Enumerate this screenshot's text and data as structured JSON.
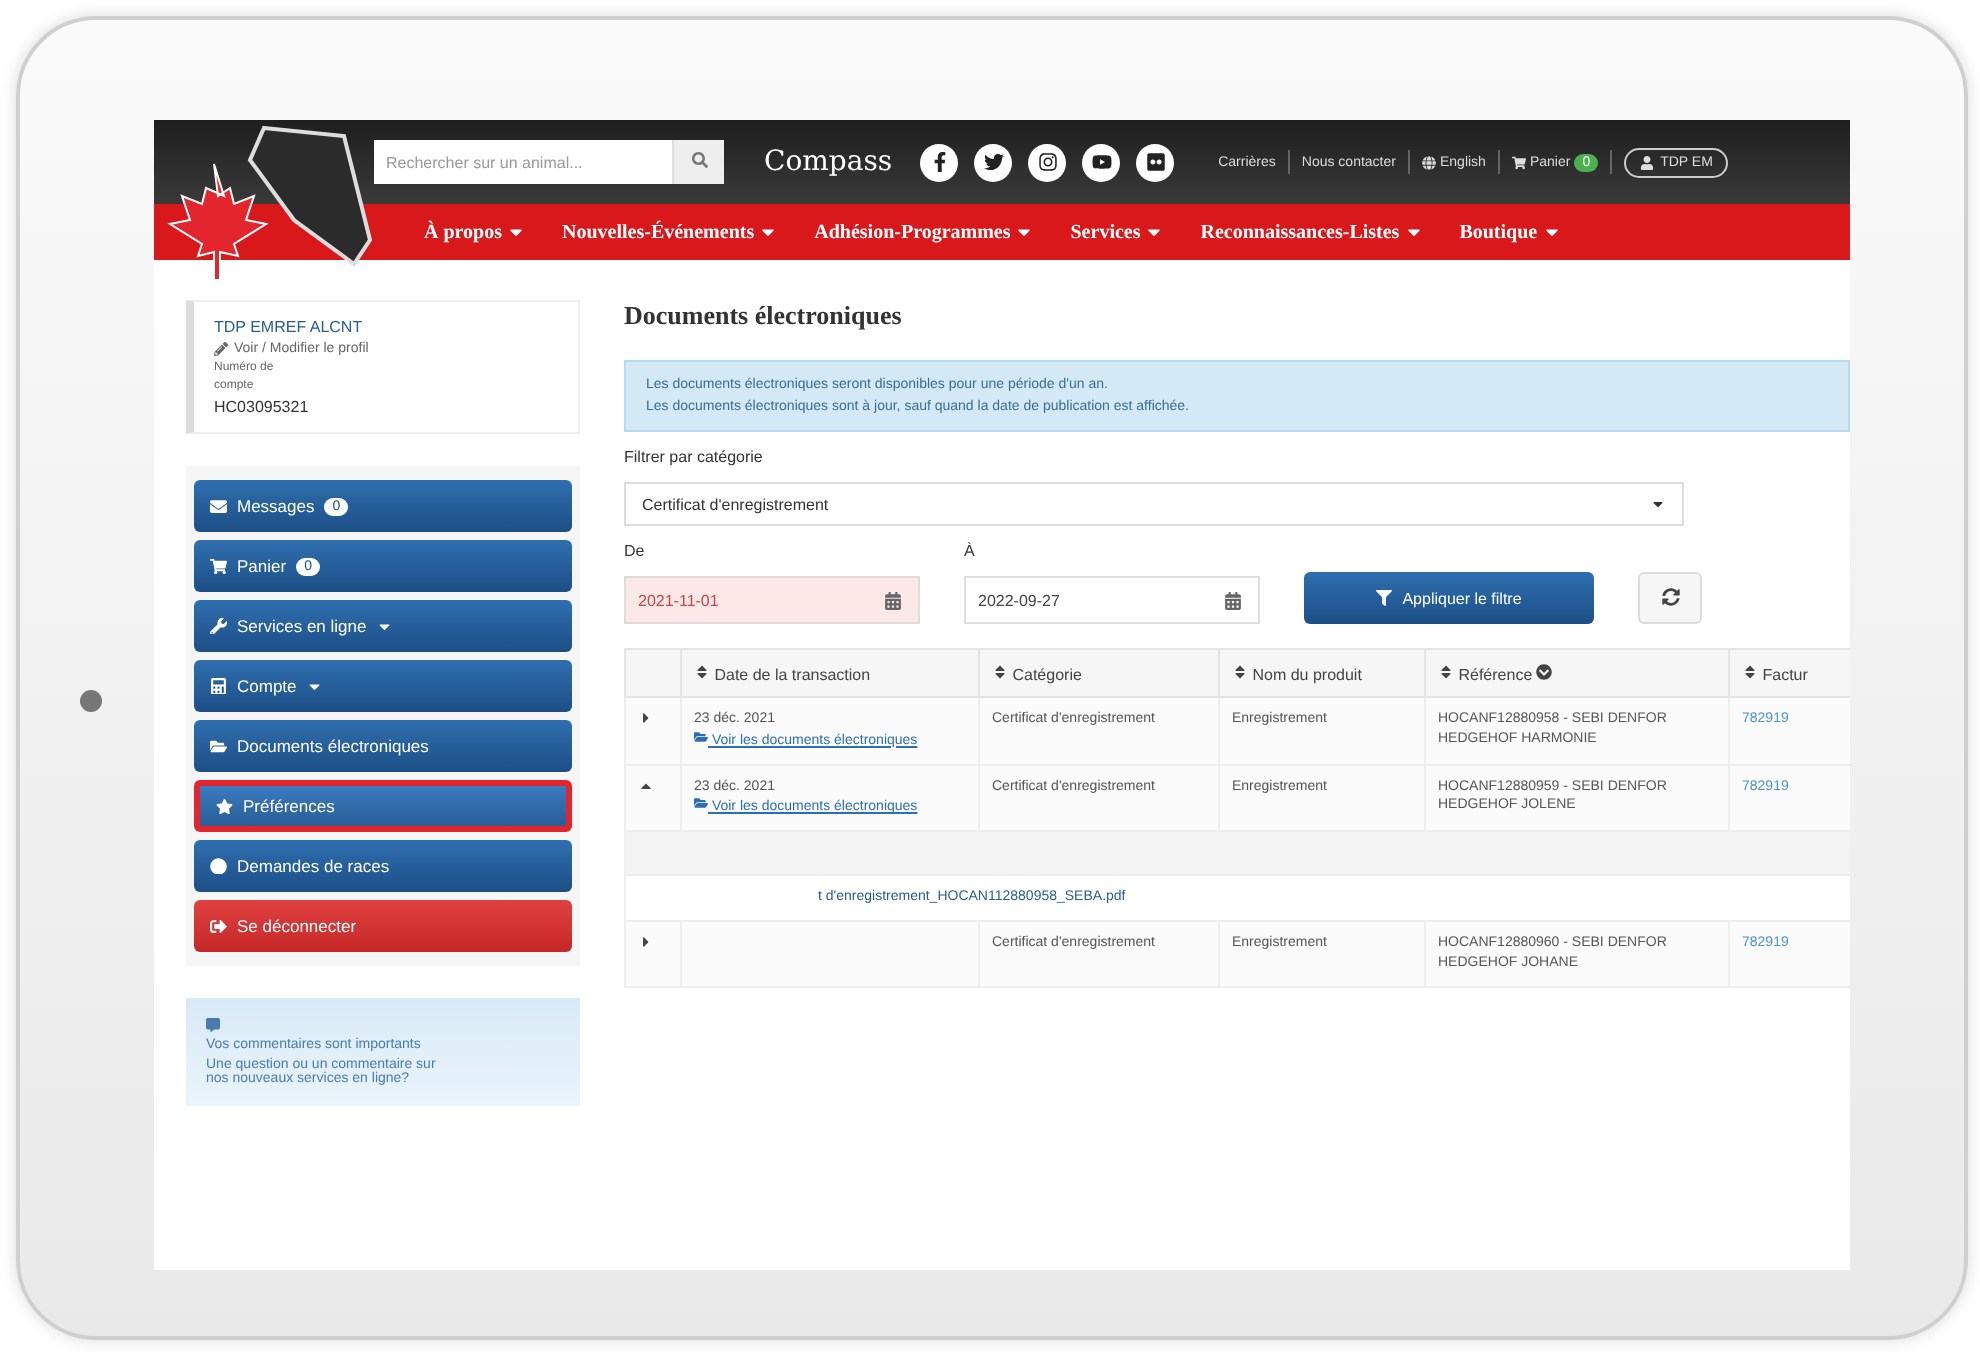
{
  "header": {
    "search": {
      "placeholder": "Rechercher sur un animal..."
    },
    "logo": "Compass",
    "links": [
      {
        "kind": "link",
        "label": "Carrières"
      },
      {
        "kind": "link",
        "label": "Nous contacter"
      },
      {
        "kind": "language",
        "label": "English"
      },
      {
        "kind": "cart",
        "label": "Panier",
        "count": "0"
      },
      {
        "kind": "user",
        "label": "TDP EM"
      }
    ]
  },
  "nav": [
    "À propos",
    "Nouvelles-Événements",
    "Adhésion-Programmes",
    "Services",
    "Reconnaissances-Listes",
    "Boutique"
  ],
  "profile": {
    "name": "TDP EMREF ALCNT",
    "edit_link": "Voir / Modifier le profil",
    "account_label": [
      "Numéro de",
      "compte"
    ],
    "account_number": "HC03095321"
  },
  "menu": [
    {
      "kind": "messages",
      "label": "Messages",
      "badge": "0",
      "dropdown": false,
      "selected": false,
      "danger": false
    },
    {
      "kind": "cart",
      "label": "Panier",
      "badge": "0",
      "dropdown": false,
      "selected": false,
      "danger": false
    },
    {
      "kind": "tools",
      "label": "Services en ligne",
      "dropdown": true,
      "selected": false,
      "danger": false
    },
    {
      "kind": "account",
      "label": "Compte",
      "dropdown": true,
      "selected": false,
      "danger": false
    },
    {
      "kind": "documents",
      "label": "Documents électroniques",
      "dropdown": false,
      "selected": false,
      "danger": false
    },
    {
      "kind": "star",
      "label": "Préférences",
      "dropdown": false,
      "selected": true,
      "danger": false
    },
    {
      "kind": "dot",
      "label": "Demandes de races",
      "dropdown": false,
      "selected": false,
      "danger": false
    },
    {
      "kind": "logout",
      "label": "Se déconnecter",
      "dropdown": false,
      "selected": false,
      "danger": true
    }
  ],
  "feedback": {
    "title": "Vos commentaires sont importants",
    "text": "Une question ou un commentaire sur nos nouveaux services en ligne?"
  },
  "main": {
    "title": "Documents électroniques",
    "notice": [
      "Les documents électroniques seront disponibles pour une période d'un an.",
      "Les documents électroniques sont à jour, sauf quand la date de publication est affichée."
    ],
    "filter": {
      "label": "Filtrer par catégorie",
      "value": "Certificat d'enregistrement",
      "from_label": "De",
      "from": "2021-11-01",
      "from_error": true,
      "to_label": "À",
      "to": "2022-09-27",
      "to_error": false,
      "apply": "Appliquer le filtre"
    },
    "table": {
      "columns": [
        "Date de la transaction",
        "Catégorie",
        "Nom du produit",
        "Référence",
        "Factur"
      ],
      "rows": [
        {
          "expanded": false,
          "date": "23 déc. 2021",
          "docs_link": "Voir les documents électroniques",
          "category": "Certificat d'enregistrement",
          "product": "Enregistrement",
          "reference": "HOCANF12880958 - SEBI DENFOR HEDGEHOF HARMONIE",
          "invoice": "782919"
        },
        {
          "expanded": true,
          "date": "23 déc. 2021",
          "docs_link": "Voir les documents électroniques",
          "category": "Certificat d'enregistrement",
          "product": "Enregistrement",
          "reference": "HOCANF12880959 - SEBI DENFOR HEDGEHOF JOLENE",
          "invoice": "782919",
          "file": "t d'enregistrement_HOCAN112880958_SEBA.pdf"
        },
        {
          "expanded": false,
          "category": "Certificat d'enregistrement",
          "product": "Enregistrement",
          "reference": "HOCANF12880960 - SEBI DENFOR HEDGEHOF JOHANE",
          "invoice": "782919"
        }
      ]
    }
  }
}
